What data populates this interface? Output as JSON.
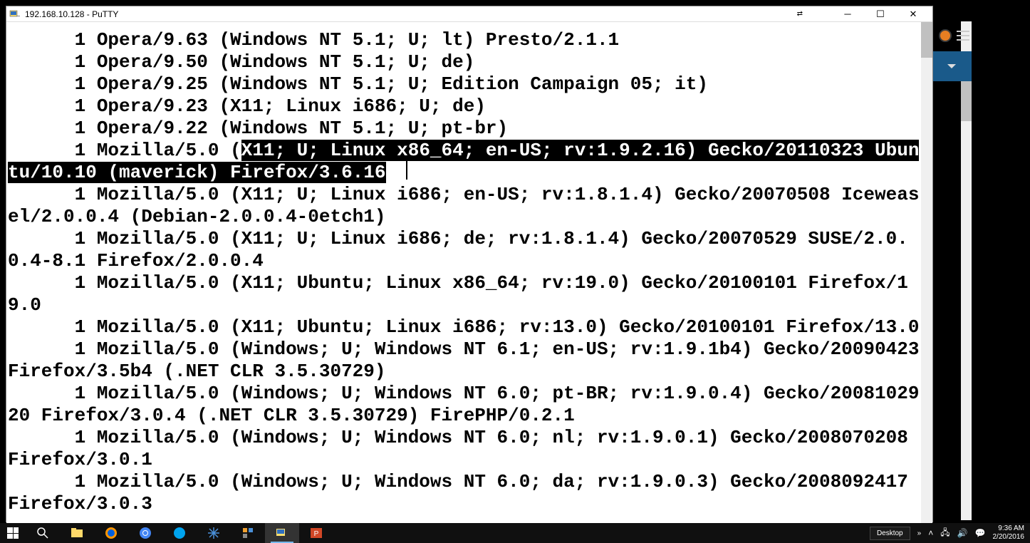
{
  "window": {
    "title": "192.168.10.128 - PuTTY"
  },
  "terminal": {
    "lines": [
      {
        "prefix": "      1 ",
        "text": "Opera/9.63 (Windows NT 5.1; U; lt) Presto/2.1.1"
      },
      {
        "prefix": "      1 ",
        "text": "Opera/9.50 (Windows NT 5.1; U; de)"
      },
      {
        "prefix": "      1 ",
        "text": "Opera/9.25 (Windows NT 5.1; U; Edition Campaign 05; it)"
      },
      {
        "prefix": "      1 ",
        "text": "Opera/9.23 (X11; Linux i686; U; de)"
      },
      {
        "prefix": "      1 ",
        "text": "Opera/9.22 (Windows NT 5.1; U; pt-br)"
      },
      {
        "prefix": "      1 ",
        "plain": "Mozilla/5.0 (",
        "highlighted": "X11; U; Linux x86_64; en-US; rv:1.9.2.16) Gecko/20110323 Ubuntu/10.10 (maverick) Firefox/3.6.16",
        "has_cursor": true
      },
      {
        "prefix": "      1 ",
        "text": "Mozilla/5.0 (X11; U; Linux i686; en-US; rv:1.8.1.4) Gecko/20070508 Iceweasel/2.0.0.4 (Debian-2.0.0.4-0etch1)"
      },
      {
        "prefix": "      1 ",
        "text": "Mozilla/5.0 (X11; U; Linux i686; de; rv:1.8.1.4) Gecko/20070529 SUSE/2.0.0.4-8.1 Firefox/2.0.0.4"
      },
      {
        "prefix": "      1 ",
        "text": "Mozilla/5.0 (X11; Ubuntu; Linux x86_64; rv:19.0) Gecko/20100101 Firefox/19.0"
      },
      {
        "prefix": "      1 ",
        "text": "Mozilla/5.0 (X11; Ubuntu; Linux i686; rv:13.0) Gecko/20100101 Firefox/13.0"
      },
      {
        "prefix": "      1 ",
        "text": "Mozilla/5.0 (Windows; U; Windows NT 6.1; en-US; rv:1.9.1b4) Gecko/20090423 Firefox/3.5b4 (.NET CLR 3.5.30729)"
      },
      {
        "prefix": "      1 ",
        "text": "Mozilla/5.0 (Windows; U; Windows NT 6.0; pt-BR; rv:1.9.0.4) Gecko/2008102920 Firefox/3.0.4 (.NET CLR 3.5.30729) FirePHP/0.2.1"
      },
      {
        "prefix": "      1 ",
        "text": "Mozilla/5.0 (Windows; U; Windows NT 6.0; nl; rv:1.9.0.1) Gecko/2008070208 Firefox/3.0.1"
      },
      {
        "prefix": "      1 ",
        "text": "Mozilla/5.0 (Windows; U; Windows NT 6.0; da; rv:1.9.0.3) Gecko/2008092417 Firefox/3.0.3"
      }
    ]
  },
  "taskbar": {
    "desktop_label": "Desktop",
    "time": "9:36 AM",
    "date": "2/20/2016"
  }
}
